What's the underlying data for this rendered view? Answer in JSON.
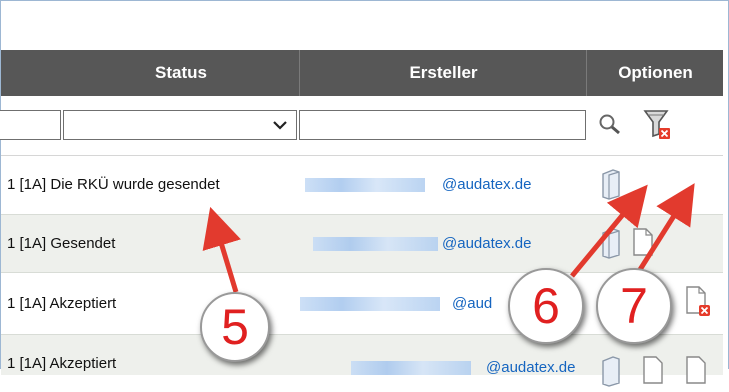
{
  "columns": {
    "status": "Status",
    "creator": "Ersteller",
    "options": "Optionen"
  },
  "filter": {
    "status_value": "",
    "creator_value": ""
  },
  "rows": [
    {
      "status": "1 [1A] Die RKÜ wurde gesendet",
      "email": "@audatex.de"
    },
    {
      "status": "1 [1A] Gesendet",
      "email": "@audatex.de"
    },
    {
      "status": "1 [1A] Akzeptiert",
      "email": "@aud"
    },
    {
      "status": "1 [1A] Akzeptiert",
      "email": "@audatex.de"
    }
  ],
  "callouts": [
    "5",
    "6",
    "7"
  ],
  "icons": {
    "search": "magnifier-icon",
    "clear_filter": "funnel-clear-icon",
    "book": "book-icon",
    "document": "document-icon",
    "document_delete": "document-delete-icon"
  },
  "colors": {
    "header_bg": "#575757",
    "alt_row": "#eef0ec",
    "email_link": "#1565c0",
    "callout_text": "#e02020"
  }
}
